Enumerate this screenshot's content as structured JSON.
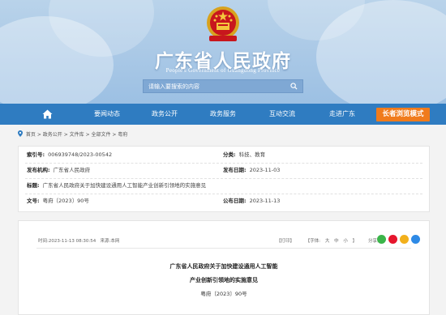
{
  "header": {
    "title": "广东省人民政府",
    "subtitle": "People's Government of Guangdong Province",
    "search_placeholder": "请输入要搜索的内容"
  },
  "nav": {
    "items": [
      "要闻动态",
      "政务公开",
      "政务服务",
      "互动交流",
      "走进广东"
    ],
    "elder_mode": "长者浏览模式"
  },
  "breadcrumb": [
    "首页",
    "政务公开",
    "文件库",
    "全部文件",
    "粤府"
  ],
  "meta": {
    "index_no_label": "索引号:",
    "index_no": "006939748/2023-00542",
    "category_label": "分类:",
    "category": "科技、教育",
    "issuer_label": "发布机构:",
    "issuer": "广东省人民政府",
    "issue_date_label": "发布日期:",
    "issue_date": "2023-11-03",
    "title_label": "标题:",
    "title": "广东省人民政府关于加快建设通用人工智能产业创新引领地的实施意见",
    "doc_no_label": "文号:",
    "doc_no": "粤府〔2023〕90号",
    "publish_date_label": "公布日期:",
    "publish_date": "2023-11-13"
  },
  "article": {
    "time_label": "时间:2023-11-13 08:30:54",
    "source_label": "来源:本网",
    "print": "【打印】",
    "font_size_label": "【字体:",
    "font_large": "大",
    "font_mid": "中",
    "font_small": "小",
    "font_close": "】",
    "share_label": "分享到:",
    "heading_line1": "广东省人民政府关于加快建设通用人工智能",
    "heading_line2": "产业创新引领地的实施意见",
    "doc_no": "粤府〔2023〕90号"
  },
  "colors": {
    "nav_bg": "#2f7cc1",
    "elder_bg": "#f07b1c",
    "share_wechat": "#3bb54a",
    "share_weibo": "#e6162d",
    "share_qzone": "#f2b01c",
    "share_qq": "#2e8ae6"
  }
}
